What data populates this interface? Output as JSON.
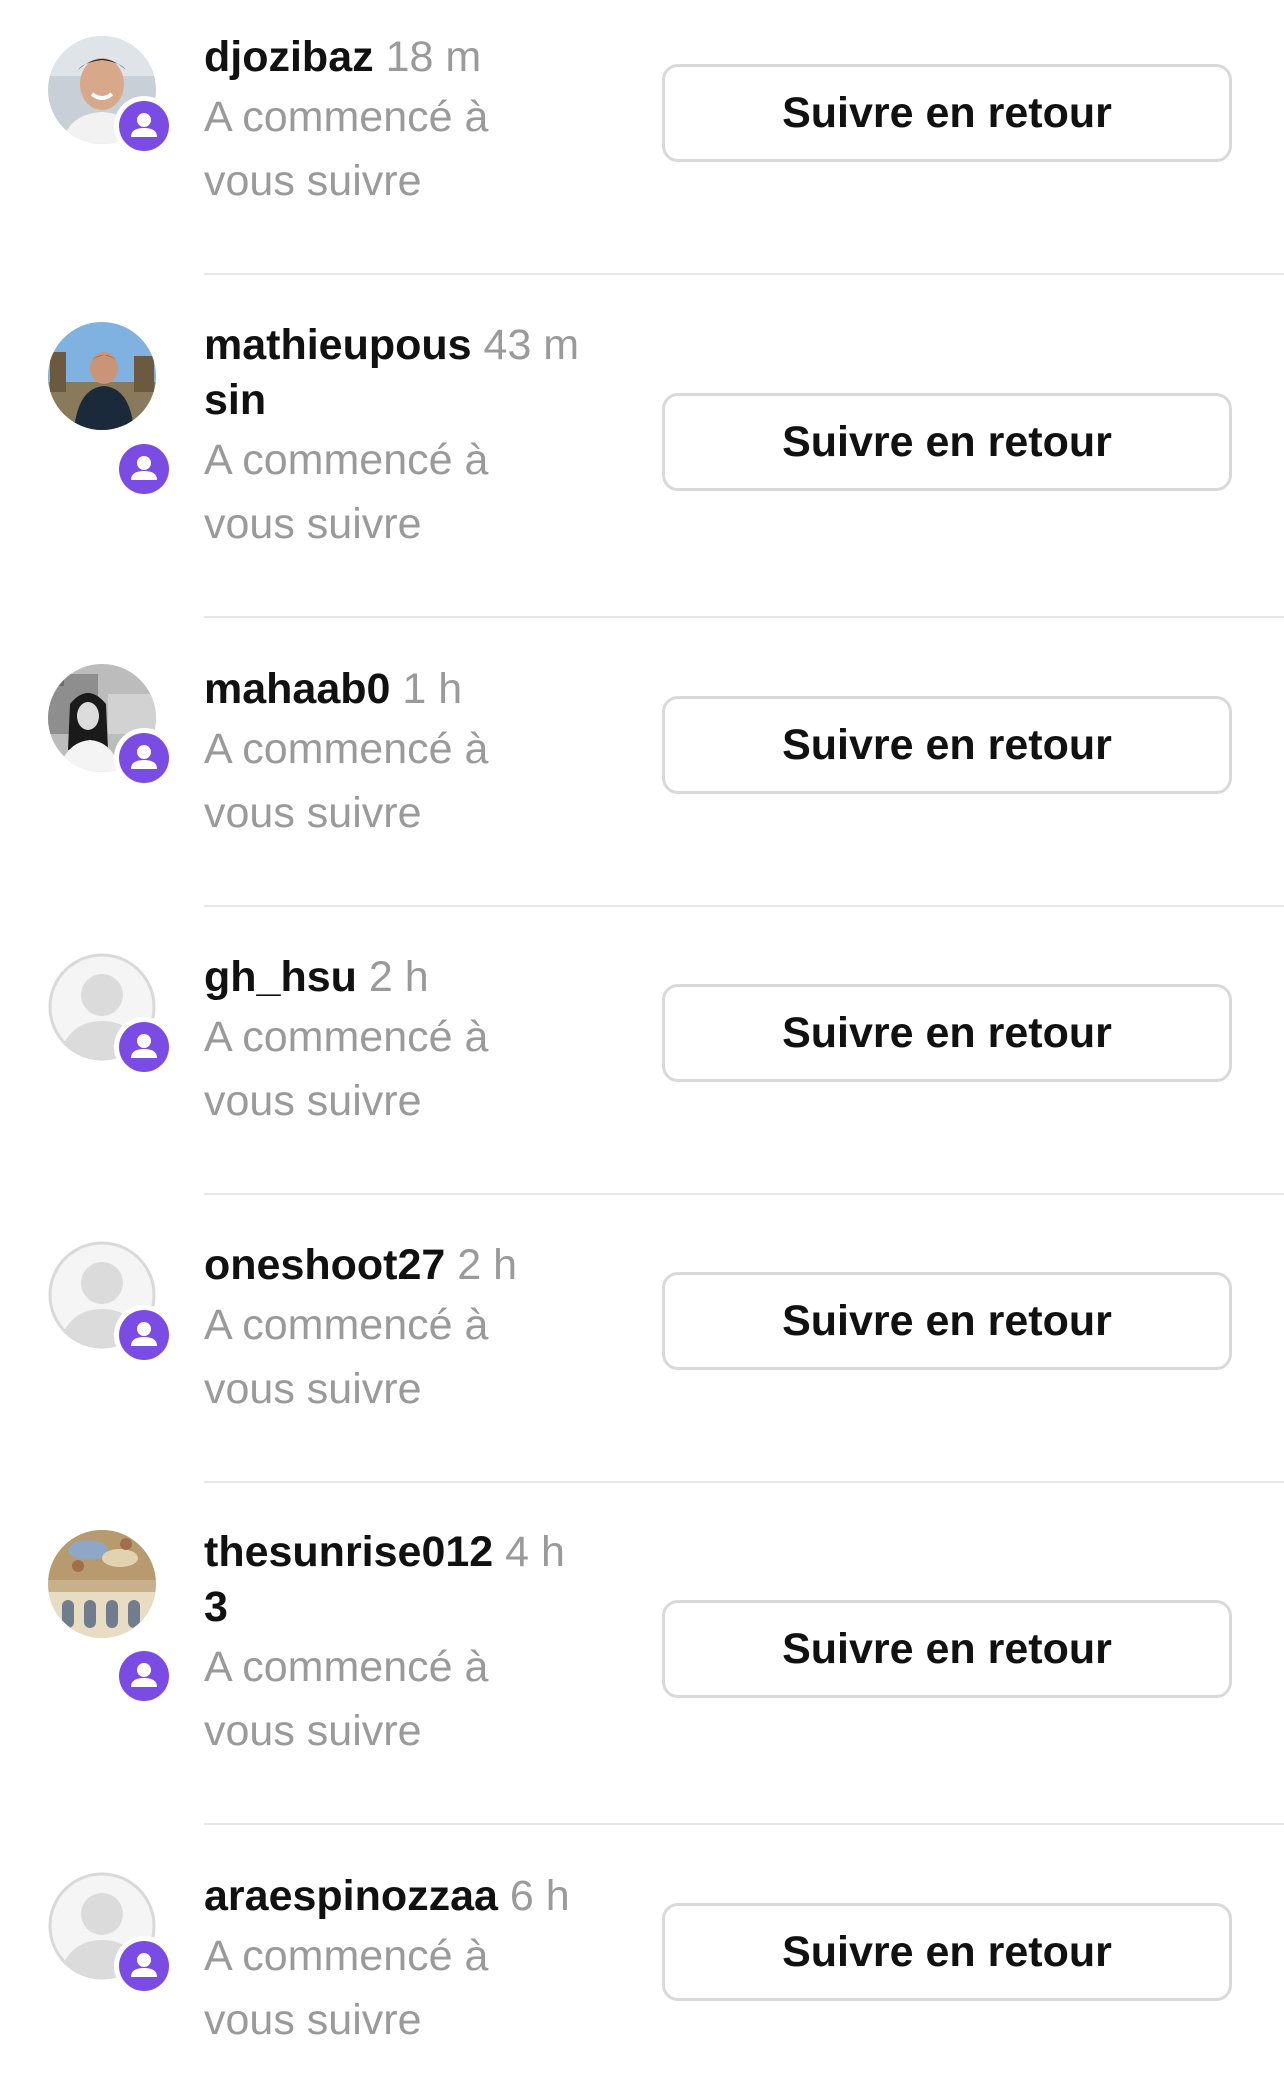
{
  "notifications": [
    {
      "username_line1": "djozibaz",
      "username_line2": "",
      "time": "18 m",
      "message_line1": "A commencé à",
      "message_line2": "vous suivre",
      "button_label": "Suivre en retour",
      "avatar": "photo-man-smiling"
    },
    {
      "username_line1": "mathieupous",
      "username_line2": "sin",
      "time": "43 m",
      "message_line1": "A commencé à",
      "message_line2": "vous suivre",
      "button_label": "Suivre en retour",
      "avatar": "photo-man-outdoors"
    },
    {
      "username_line1": "mahaab0",
      "username_line2": "",
      "time": "1 h",
      "message_line1": "A commencé à",
      "message_line2": "vous suivre",
      "button_label": "Suivre en retour",
      "avatar": "photo-woman-bw"
    },
    {
      "username_line1": "gh_hsu",
      "username_line2": "",
      "time": "2 h",
      "message_line1": "A commencé à",
      "message_line2": "vous suivre",
      "button_label": "Suivre en retour",
      "avatar": "default-person-icon"
    },
    {
      "username_line1": "oneshoot27",
      "username_line2": "",
      "time": "2 h",
      "message_line1": "A commencé à",
      "message_line2": "vous suivre",
      "button_label": "Suivre en retour",
      "avatar": "default-person-icon"
    },
    {
      "username_line1": "thesunrise012",
      "username_line2": "3",
      "time": "4 h",
      "message_line1": "A commencé à",
      "message_line2": "vous suivre",
      "button_label": "Suivre en retour",
      "avatar": "photo-palace-ceiling"
    },
    {
      "username_line1": "araespinozzaa",
      "username_line2": "",
      "time": "6 h",
      "message_line1": "A commencé à",
      "message_line2": "vous suivre",
      "button_label": "Suivre en retour",
      "avatar": "default-person-icon"
    }
  ],
  "colors": {
    "badge": "#7b4ce3",
    "secondary_text": "#9a9a9a",
    "button_border": "#d9d9d9",
    "divider": "#e6e6e6"
  },
  "icons": {
    "badge_icon": "new-follower-person-icon",
    "default_avatar": "default-person-icon"
  }
}
